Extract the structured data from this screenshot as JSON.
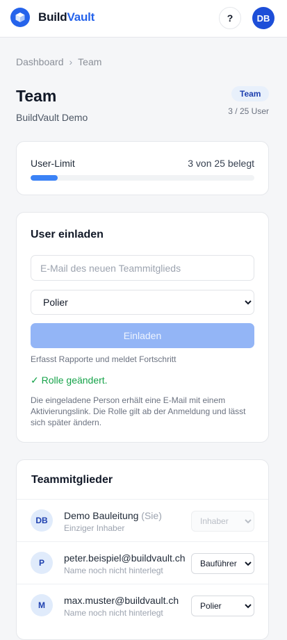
{
  "header": {
    "brand_main": "Build",
    "brand_accent": "Vault",
    "help_label": "?",
    "user_initials": "DB",
    "accent_color": "#2563eb"
  },
  "breadcrumb": {
    "root": "Dashboard",
    "separator": "›",
    "current": "Team"
  },
  "page": {
    "title": "Team",
    "subtitle": "BuildVault Demo",
    "badge": "Team",
    "user_count": "3 / 25 User"
  },
  "user_limit": {
    "label": "User-Limit",
    "value_text": "3 von 25 belegt",
    "used": 3,
    "total": 25
  },
  "invite": {
    "title": "User einladen",
    "email_placeholder": "E-Mail des neuen Teammitglieds",
    "email_value": "",
    "role_options": [
      "Polier",
      "Bauführer",
      "Inhaber"
    ],
    "selected_role": "Polier",
    "button_label": "Einladen",
    "role_hint": "Erfasst Rapporte und meldet Fortschritt",
    "success_message": "✓ Rolle geändert.",
    "info_text": "Die eingeladene Person erhält eine E-Mail mit einem Aktivierungslink. Die Rolle gilt ab der Anmeldung und lässt sich später ändern."
  },
  "members": {
    "title": "Teammitglieder",
    "rows": [
      {
        "initials": "DB",
        "name": "Demo Bauleitung",
        "you_tag": "(Sie)",
        "subtitle": "Einziger Inhaber",
        "role": "Inhaber"
      },
      {
        "initials": "P",
        "name": "peter.beispiel@buildvault.ch",
        "you_tag": "",
        "subtitle": "Name noch nicht hinterlegt",
        "role": "Bauführer"
      },
      {
        "initials": "M",
        "name": "max.muster@buildvault.ch",
        "you_tag": "",
        "subtitle": "Name noch nicht hinterlegt",
        "role": "Polier"
      }
    ]
  }
}
